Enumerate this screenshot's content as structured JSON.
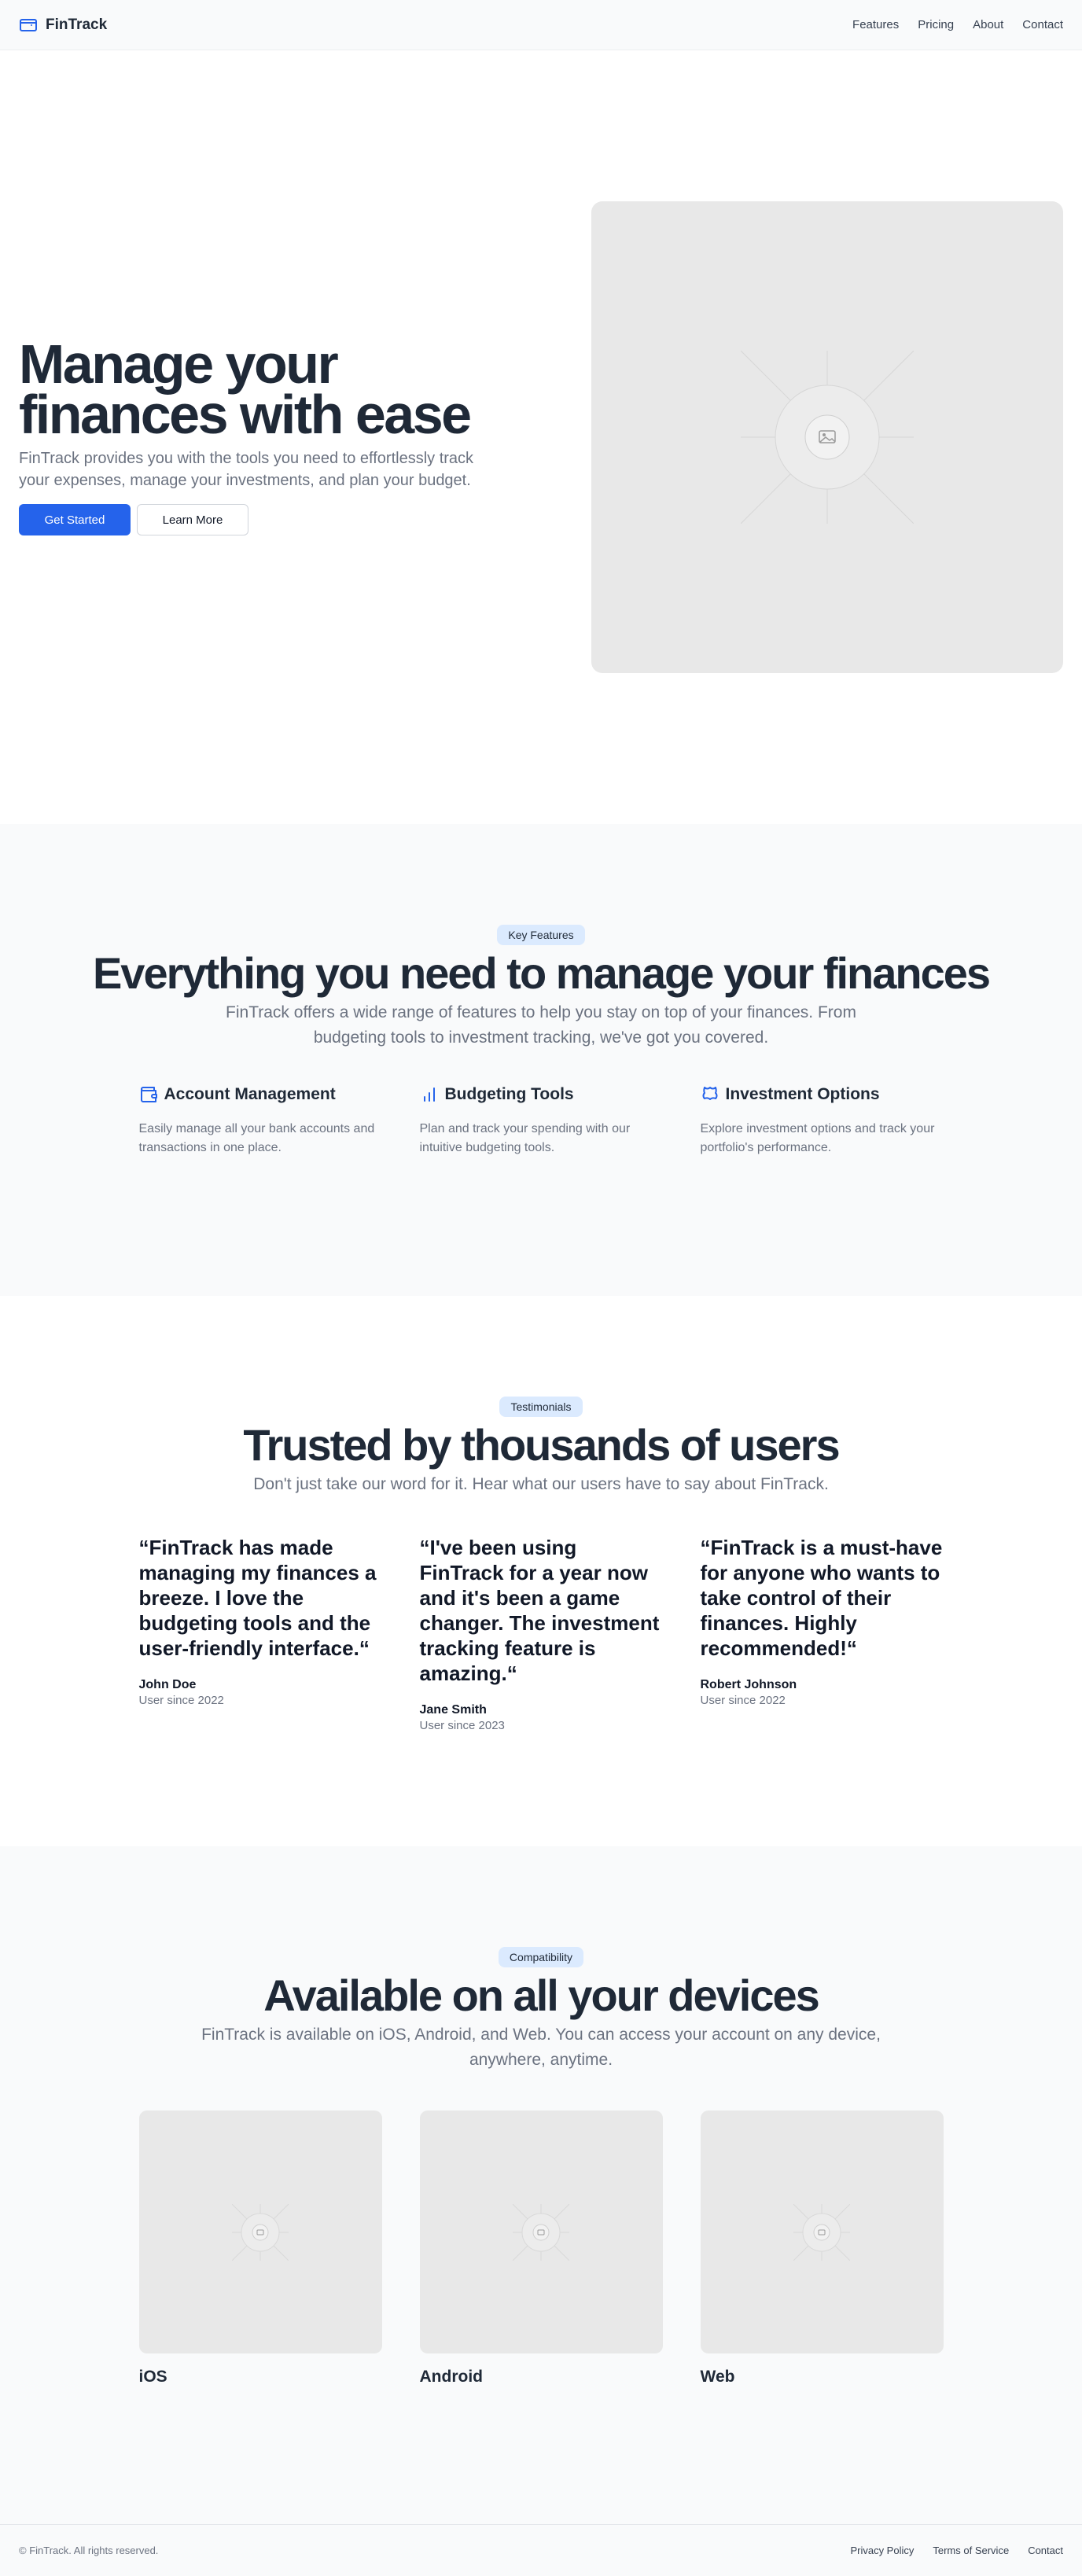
{
  "nav": {
    "brand": "FinTrack",
    "brand_icon": "wallet-icon",
    "links": [
      "Features",
      "Pricing",
      "About",
      "Contact"
    ]
  },
  "hero": {
    "title": "Manage your finances with ease",
    "subtitle": "FinTrack provides you with the tools you need to effortlessly track your expenses, manage your investments, and plan your budget.",
    "primary_button": "Get Started",
    "secondary_button": "Learn More",
    "image_icon": "image-placeholder-icon"
  },
  "features": {
    "badge": "Key Features",
    "title": "Everything you need to manage your finances",
    "subtitle": "FinTrack offers a wide range of features to help you stay on top of your finances. From budgeting tools to investment tracking, we've got you covered.",
    "items": [
      {
        "icon": "wallet-icon",
        "title": "Account Management",
        "desc": "Easily manage all your bank accounts and transactions in one place."
      },
      {
        "icon": "bar-chart-icon",
        "title": "Budgeting Tools",
        "desc": "Plan and track your spending with our intuitive budgeting tools."
      },
      {
        "icon": "investment-icon",
        "title": "Investment Options",
        "desc": "Explore investment options and track your portfolio's performance."
      }
    ]
  },
  "testimonials": {
    "badge": "Testimonials",
    "title": "Trusted by thousands of users",
    "subtitle": "Don't just take our word for it. Hear what our users have to say about FinTrack.",
    "items": [
      {
        "quote": "“FinTrack has made managing my finances a breeze. I love the budgeting tools and the user-friendly interface.“",
        "name": "John Doe",
        "since": "User since 2022"
      },
      {
        "quote": "“I've been using FinTrack for a year now and it's been a game changer. The investment tracking feature is amazing.“",
        "name": "Jane Smith",
        "since": "User since 2023"
      },
      {
        "quote": "“FinTrack is a must-have for anyone who wants to take control of their finances. Highly recommended!“",
        "name": "Robert Johnson",
        "since": "User since 2022"
      }
    ]
  },
  "devices": {
    "badge": "Compatibility",
    "title": "Available on all your devices",
    "subtitle": "FinTrack is available on iOS, Android, and Web. You can access your account on any device, anywhere, anytime.",
    "items": [
      {
        "name": "iOS"
      },
      {
        "name": "Android"
      },
      {
        "name": "Web"
      }
    ]
  },
  "footer": {
    "copyright": "© FinTrack. All rights reserved.",
    "links": [
      "Privacy Policy",
      "Terms of Service",
      "Contact"
    ]
  },
  "colors": {
    "primary": "#2563eb",
    "badge_bg": "#dbeafe",
    "heading": "#1f2937",
    "muted": "#6b7280",
    "section_bg": "#f9fafb"
  }
}
